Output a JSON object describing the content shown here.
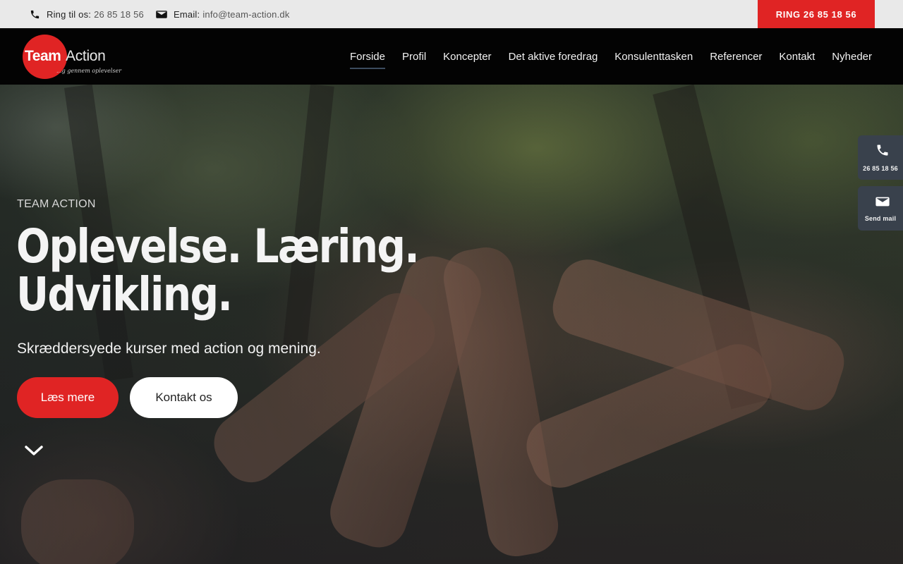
{
  "topbar": {
    "phone_label": "Ring til os:",
    "phone_value": "26 85 18 56",
    "email_label": "Email:",
    "email_value": "info@team-action.dk",
    "call_button": "RING 26 85 18 56"
  },
  "logo": {
    "team": "Team",
    "action": "Action",
    "tagline": "...g gennem oplevelser"
  },
  "nav": {
    "items": [
      {
        "label": "Forside",
        "active": true
      },
      {
        "label": "Profil"
      },
      {
        "label": "Koncepter"
      },
      {
        "label": "Det aktive foredrag"
      },
      {
        "label": "Konsulenttasken"
      },
      {
        "label": "Referencer"
      },
      {
        "label": "Kontakt"
      },
      {
        "label": "Nyheder"
      }
    ]
  },
  "hero": {
    "eyebrow": "TEAM ACTION",
    "headline_line1": "Oplevelse. Læring.",
    "headline_line2": "Udvikling.",
    "subheading": "Skræddersyede kurser med action og mening.",
    "primary_button": "Læs mere",
    "secondary_button": "Kontakt os"
  },
  "side_widgets": {
    "phone_label": "26 85 18 56",
    "mail_label": "Send mail"
  },
  "colors": {
    "accent": "#e02424",
    "topbar_bg": "#e9e9e9",
    "header_bg": "#030303",
    "widget_bg": "#39414c"
  },
  "icons": {
    "phone": "phone-icon",
    "email": "envelope-icon",
    "scroll": "chevron-down-icon"
  }
}
